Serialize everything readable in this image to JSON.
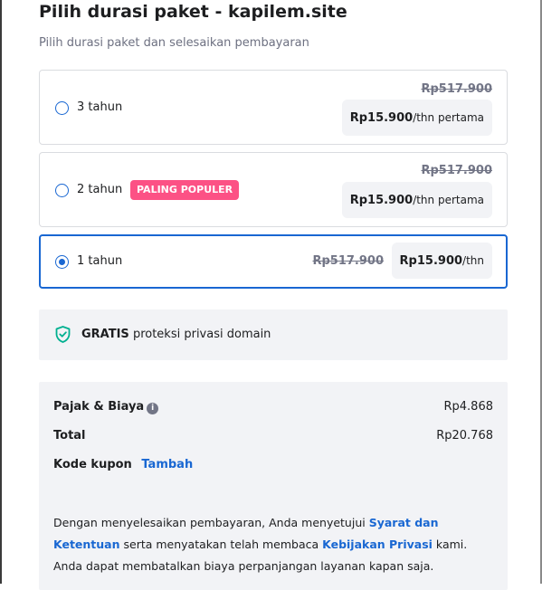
{
  "header": {
    "title": "Pilih durasi paket - kapilem.site",
    "subtitle": "Pilih durasi paket dan selesaikan pembayaran"
  },
  "plans": [
    {
      "label": "3 tahun",
      "old_price": "Rp517.900",
      "price": "Rp15.900",
      "unit": "/thn pertama",
      "selected": false
    },
    {
      "label": "2 tahun",
      "badge": "PALING POPULER",
      "old_price": "Rp517.900",
      "price": "Rp15.900",
      "unit": "/thn pertama",
      "selected": false
    },
    {
      "label": "1 tahun",
      "old_price": "Rp517.900",
      "price": "Rp15.900",
      "unit": "/thn",
      "selected": true
    }
  ],
  "privacy": {
    "bold": "GRATIS",
    "text": " proteksi privasi domain",
    "icon": "shield-check-icon"
  },
  "summary": {
    "tax_label": "Pajak & Biaya",
    "tax_value": "Rp4.868",
    "total_label": "Total",
    "total_value": "Rp20.768",
    "coupon_label": "Kode kupon",
    "coupon_link": "Tambah"
  },
  "legal": {
    "part1": "Dengan menyelesaikan pembayaran, Anda menyetujui ",
    "terms_link": "Syarat dan Ketentuan",
    "part2": " serta menyatakan telah membaca ",
    "privacy_link": "Kebijakan Privasi",
    "part3": " kami. Anda dapat membatalkan biaya perpanjangan layanan kapan saja."
  },
  "colors": {
    "accent": "#1967d2",
    "badge": "#fc5185",
    "shield": "#00b090",
    "panel": "#f2f3f6"
  }
}
